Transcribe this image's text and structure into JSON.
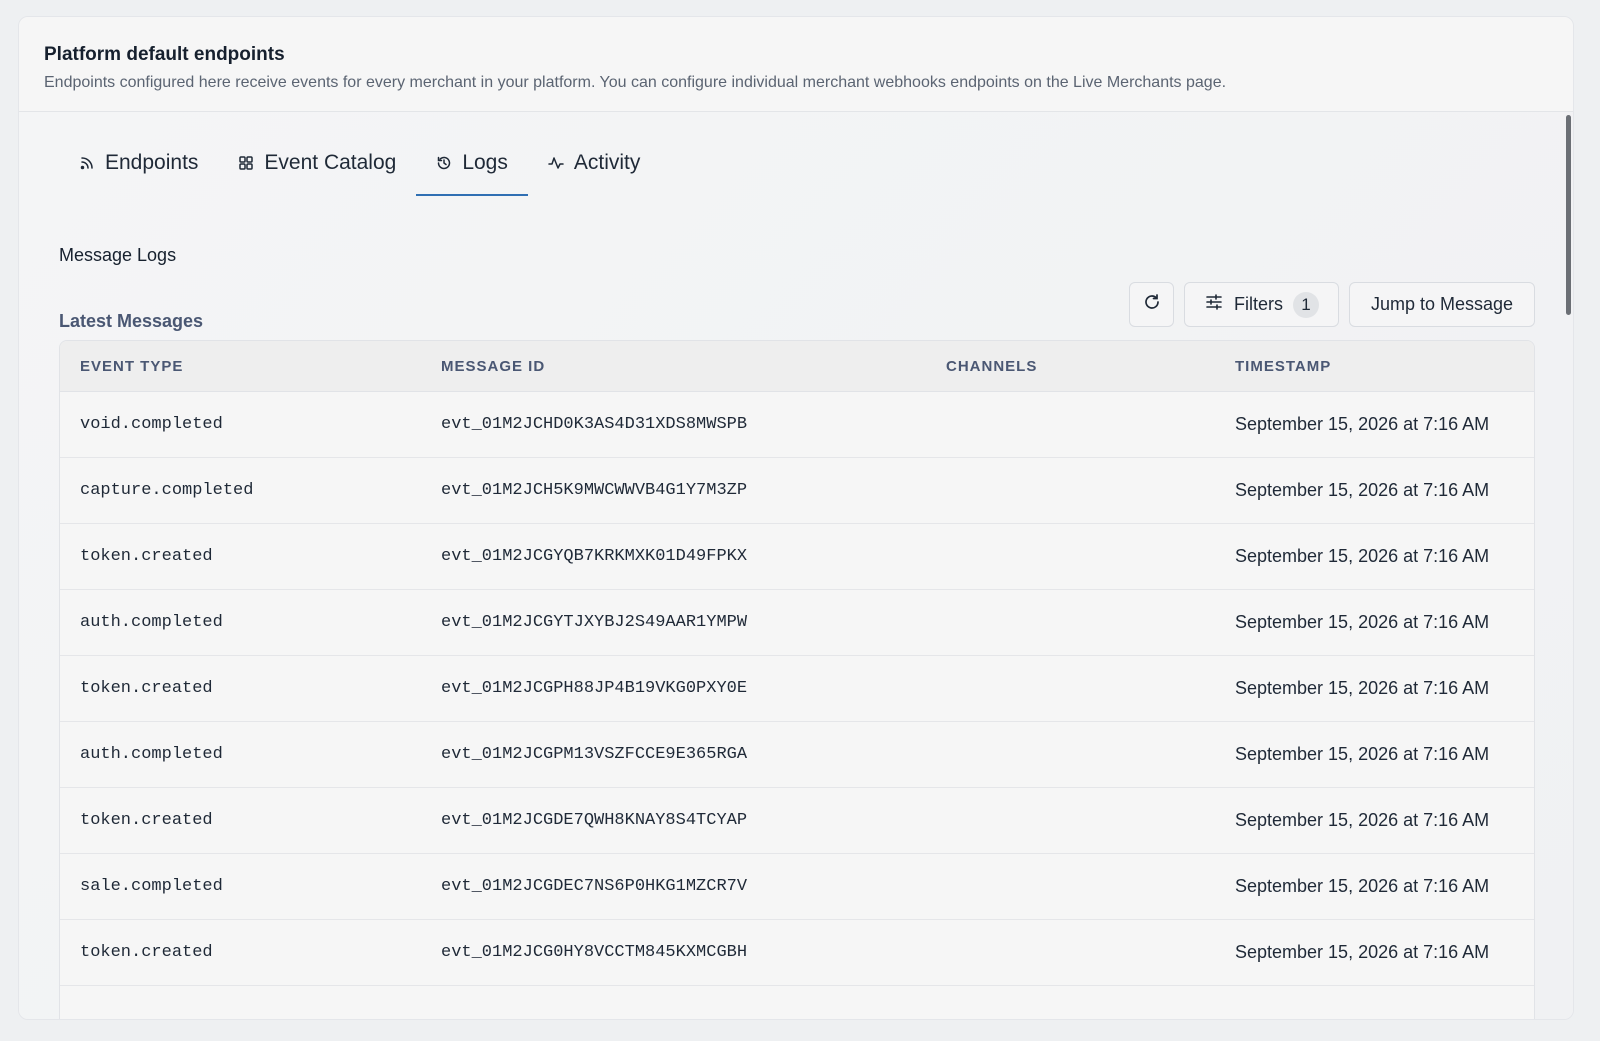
{
  "header": {
    "title": "Platform default endpoints",
    "description": "Endpoints configured here receive events for every merchant in your platform. You can configure individual merchant webhooks endpoints on the Live Merchants page."
  },
  "tabs": [
    {
      "label": "Endpoints",
      "icon": "rss-icon"
    },
    {
      "label": "Event Catalog",
      "icon": "grid-icon"
    },
    {
      "label": "Logs",
      "icon": "history-icon",
      "active": true
    },
    {
      "label": "Activity",
      "icon": "activity-icon"
    }
  ],
  "section_label": "Message Logs",
  "latest_label": "Latest Messages",
  "toolbar": {
    "refresh_icon": "refresh-icon",
    "filters_label": "Filters",
    "filters_count": "1",
    "jump_label": "Jump to Message"
  },
  "table": {
    "columns": [
      "EVENT TYPE",
      "MESSAGE ID",
      "CHANNELS",
      "TIMESTAMP"
    ],
    "rows": [
      {
        "event": "void.completed",
        "id": "evt_01M2JCHD0K3AS4D31XDS8MWSPB",
        "channels": "",
        "timestamp": "September 15, 2026 at 7:16 AM"
      },
      {
        "event": "capture.completed",
        "id": "evt_01M2JCH5K9MWCWWVB4G1Y7M3ZP",
        "channels": "",
        "timestamp": "September 15, 2026 at 7:16 AM"
      },
      {
        "event": "token.created",
        "id": "evt_01M2JCGYQB7KRKMXK01D49FPKX",
        "channels": "",
        "timestamp": "September 15, 2026 at 7:16 AM"
      },
      {
        "event": "auth.completed",
        "id": "evt_01M2JCGYTJXYBJ2S49AAR1YMPW",
        "channels": "",
        "timestamp": "September 15, 2026 at 7:16 AM"
      },
      {
        "event": "token.created",
        "id": "evt_01M2JCGPH88JP4B19VKG0PXY0E",
        "channels": "",
        "timestamp": "September 15, 2026 at 7:16 AM"
      },
      {
        "event": "auth.completed",
        "id": "evt_01M2JCGPM13VSZFCCE9E365RGA",
        "channels": "",
        "timestamp": "September 15, 2026 at 7:16 AM"
      },
      {
        "event": "token.created",
        "id": "evt_01M2JCGDE7QWH8KNAY8S4TCYAP",
        "channels": "",
        "timestamp": "September 15, 2026 at 7:16 AM"
      },
      {
        "event": "sale.completed",
        "id": "evt_01M2JCGDEC7NS6P0HKG1MZCR7V",
        "channels": "",
        "timestamp": "September 15, 2026 at 7:16 AM"
      },
      {
        "event": "token.created",
        "id": "evt_01M2JCG0HY8VCCTM845KXMCGBH",
        "channels": "",
        "timestamp": "September 15, 2026 at 7:16 AM"
      }
    ]
  },
  "colors": {
    "accent": "#2f6fb3",
    "header_text": "#4a5773"
  }
}
